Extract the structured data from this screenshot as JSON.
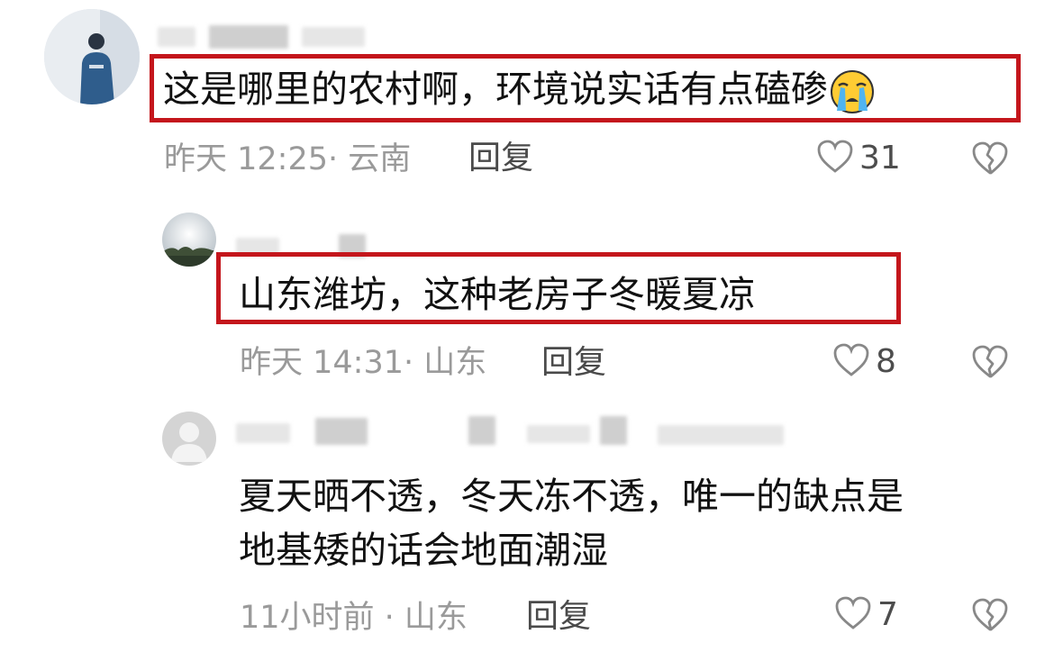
{
  "comments": [
    {
      "text": "这是哪里的农村啊，环境说实话有点磕碜",
      "emoji": "crying-face-icon",
      "meta": "昨天 12:25· 云南",
      "reply": "回复",
      "likes": "31"
    },
    {
      "text": "山东潍坊，这种老房子冬暖夏凉",
      "meta": "昨天 14:31· 山东",
      "reply": "回复",
      "likes": "8"
    },
    {
      "text_line1": "夏天晒不透，冬天冻不透，唯一的缺点是",
      "text_line2": "地基矮的话会地面潮湿",
      "meta": "11小时前 · 山东",
      "reply": "回复",
      "likes": "7"
    }
  ],
  "colors": {
    "highlight": "#c4161c",
    "meta": "#9a9a9a"
  }
}
